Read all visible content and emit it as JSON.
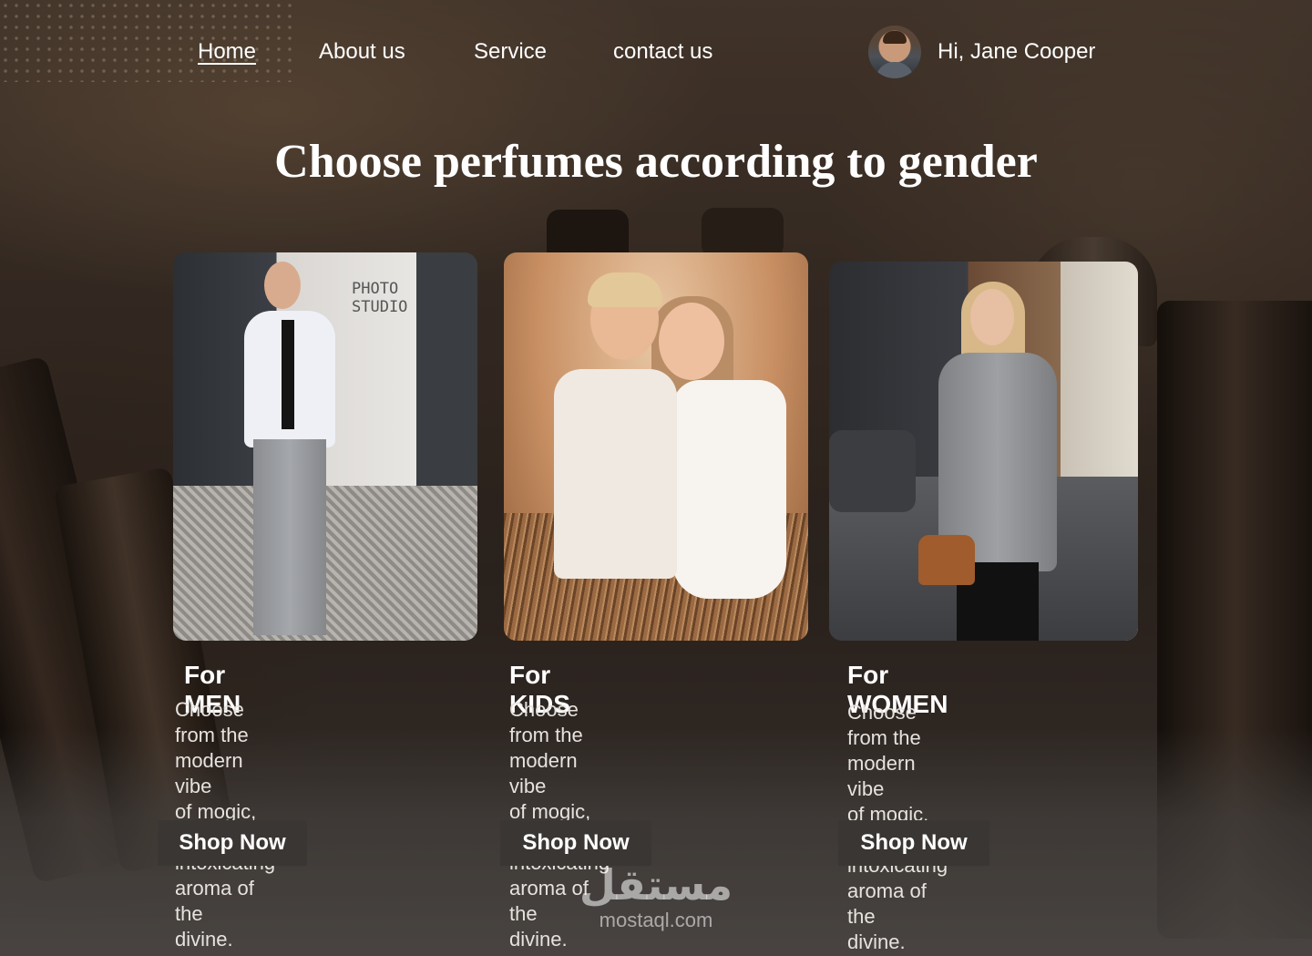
{
  "nav": {
    "links": [
      {
        "label": "Home",
        "active": true
      },
      {
        "label": "About us",
        "active": false
      },
      {
        "label": "Service",
        "active": false
      },
      {
        "label": "contact us",
        "active": false
      }
    ],
    "user_greeting": "Hi, Jane Cooper"
  },
  "page_title": "Choose perfumes according to gender",
  "cards": [
    {
      "title": "For MEN",
      "desc_lines": [
        "Choose from the modern vibe",
        "of mogic, the",
        "intoxicating aroma of the",
        "divine."
      ],
      "button": "Shop Now",
      "photo_sign": [
        "PHOTO",
        "STUDIO"
      ]
    },
    {
      "title": "For KIDS",
      "desc_lines": [
        "Choose from the modern vibe",
        "of mogic, the",
        "intoxicating aroma of the",
        "divine."
      ],
      "button": "Shop Now"
    },
    {
      "title": "For WOMEN",
      "desc_lines": [
        "Choose from the modern vibe",
        "of mogic, the",
        "intoxicating aroma of the",
        "divine."
      ],
      "button": "Shop Now"
    }
  ],
  "watermark": {
    "arabic": "مستقل",
    "latin": "mostaql.com"
  }
}
